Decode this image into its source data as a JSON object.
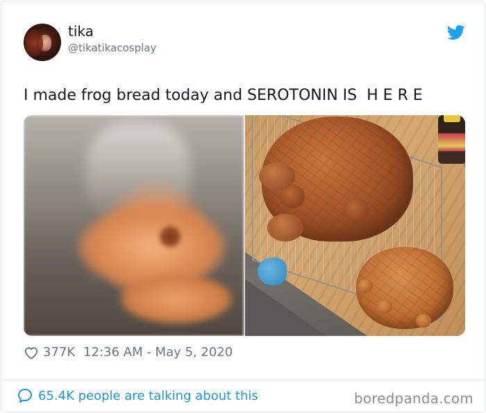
{
  "tweet": {
    "display_name": "tika",
    "handle": "@tikatikacosplay",
    "text": "I made frog bread today and SEROTONIN IS  H E R E",
    "likes": "377K",
    "timestamp": "12:36 AM - May 5, 2020",
    "talking": "65.4K people are talking about this"
  },
  "icons": {
    "brand": "twitter-bird-icon",
    "like": "heart-icon",
    "talk": "speech-bubble-icon"
  },
  "colors": {
    "twitter_blue": "#1da1f2",
    "link_blue": "#1b95e0",
    "muted_gray": "#657786"
  },
  "watermark": "boredpanda.com"
}
